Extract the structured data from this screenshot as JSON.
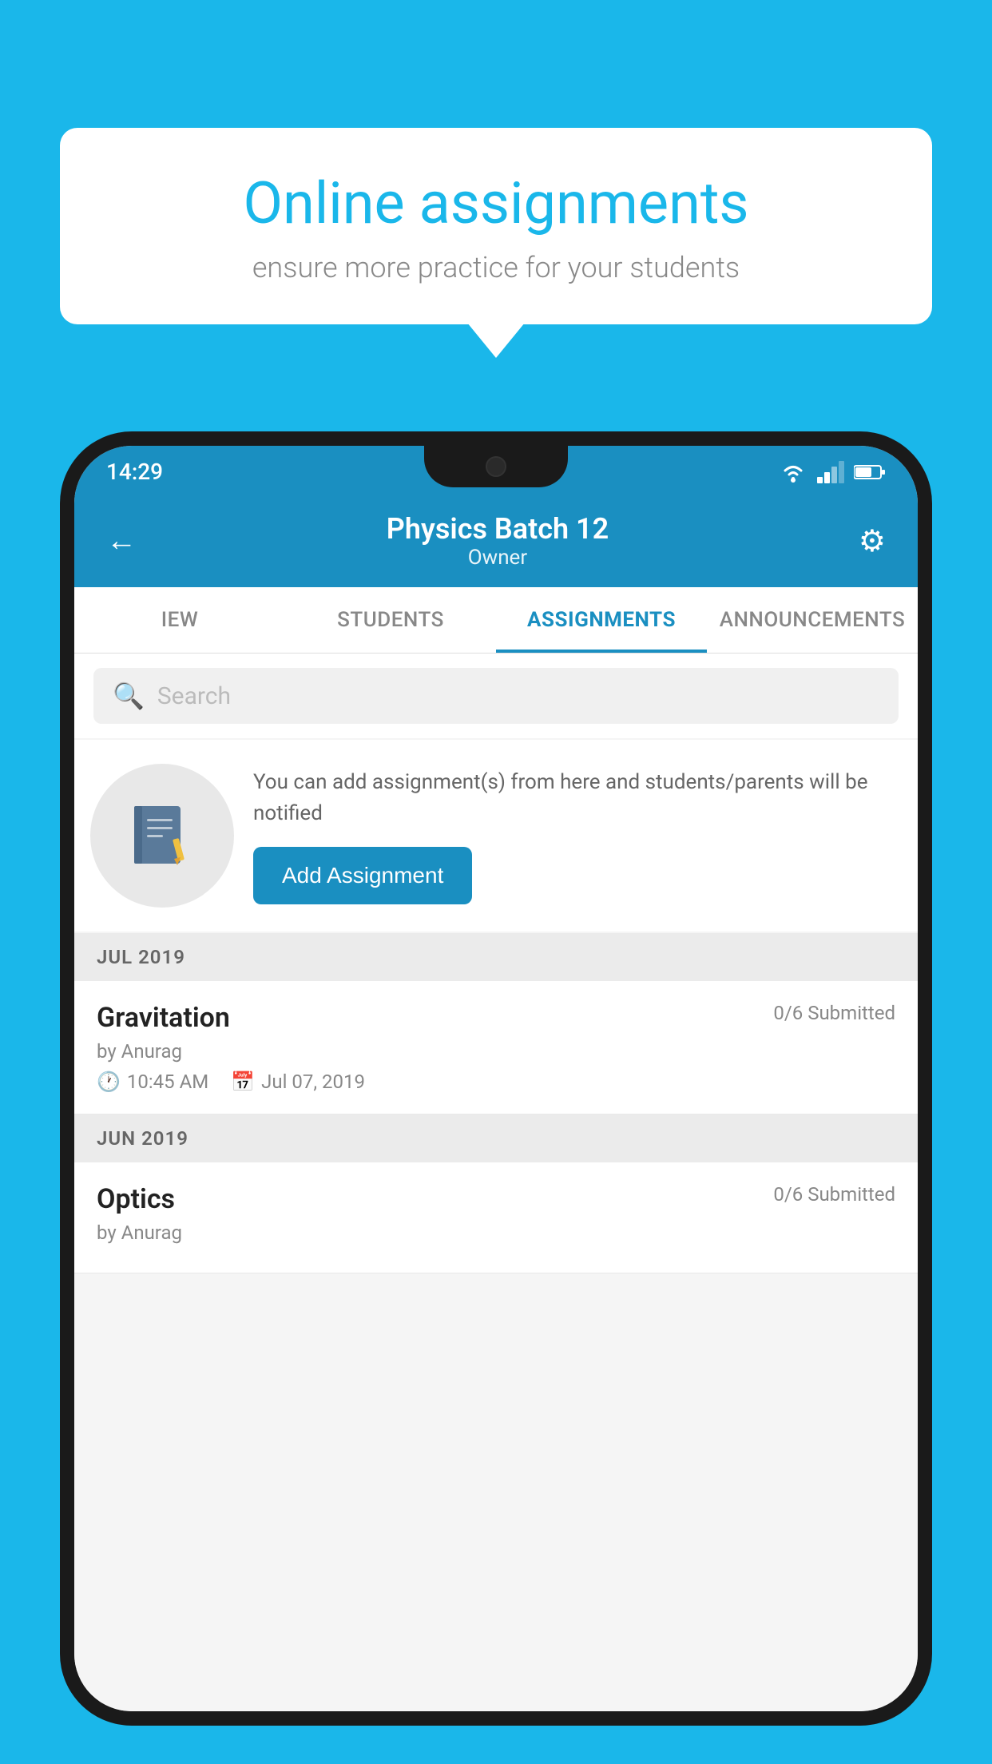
{
  "background_color": "#1ab7ea",
  "speech_bubble": {
    "title": "Online assignments",
    "subtitle": "ensure more practice for your students"
  },
  "phone": {
    "status_bar": {
      "time": "14:29"
    },
    "header": {
      "title": "Physics Batch 12",
      "subtitle": "Owner",
      "back_label": "←",
      "settings_label": "⚙"
    },
    "tabs": [
      {
        "label": "IEW",
        "active": false
      },
      {
        "label": "STUDENTS",
        "active": false
      },
      {
        "label": "ASSIGNMENTS",
        "active": true
      },
      {
        "label": "ANNOUNCEMENTS",
        "active": false
      }
    ],
    "search": {
      "placeholder": "Search"
    },
    "promo": {
      "text": "You can add assignment(s) from here and students/parents will be notified",
      "button_label": "Add Assignment"
    },
    "sections": [
      {
        "header": "JUL 2019",
        "assignments": [
          {
            "name": "Gravitation",
            "submitted": "0/6 Submitted",
            "by": "by Anurag",
            "time": "10:45 AM",
            "date": "Jul 07, 2019"
          }
        ]
      },
      {
        "header": "JUN 2019",
        "assignments": [
          {
            "name": "Optics",
            "submitted": "0/6 Submitted",
            "by": "by Anurag",
            "time": "",
            "date": ""
          }
        ]
      }
    ]
  }
}
